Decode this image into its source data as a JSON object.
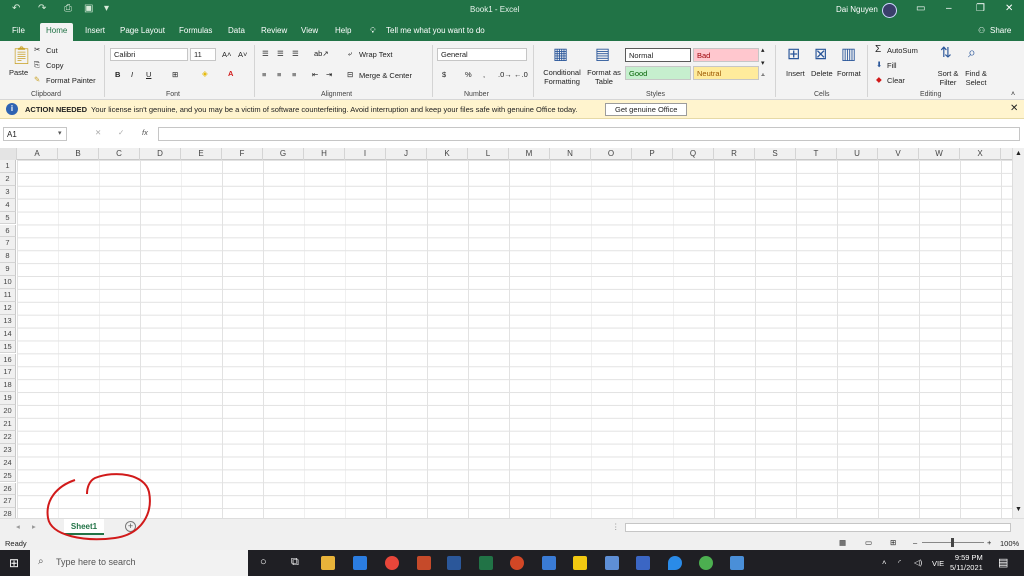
{
  "window": {
    "title": "Book1 - Excel",
    "user": "Dai Nguyen"
  },
  "ribbon_tabs": [
    "File",
    "Home",
    "Insert",
    "Page Layout",
    "Formulas",
    "Data",
    "Review",
    "View",
    "Help"
  ],
  "tell_me": "Tell me what you want to do",
  "share": "Share",
  "clipboard": {
    "paste": "Paste",
    "cut": "Cut",
    "copy": "Copy",
    "format_painter": "Format Painter",
    "label": "Clipboard"
  },
  "font": {
    "name": "Calibri",
    "size": "11",
    "label": "Font"
  },
  "alignment": {
    "wrap": "Wrap Text",
    "merge": "Merge & Center",
    "label": "Alignment"
  },
  "number": {
    "format": "General",
    "label": "Number"
  },
  "styles": {
    "conditional": "Conditional Formatting",
    "format_table": "Format as Table",
    "normal": "Normal",
    "bad": "Bad",
    "good": "Good",
    "neutral": "Neutral",
    "label": "Styles"
  },
  "cells": {
    "insert": "Insert",
    "delete": "Delete",
    "format": "Format",
    "label": "Cells"
  },
  "editing": {
    "autosum": "AutoSum",
    "fill": "Fill",
    "clear": "Clear",
    "sort": "Sort & Filter",
    "find": "Find & Select",
    "label": "Editing"
  },
  "message": {
    "title": "ACTION NEEDED",
    "text": "Your license isn't genuine, and you may be a victim of software counterfeiting. Avoid interruption and keep your files safe with genuine Office today.",
    "button": "Get genuine Office"
  },
  "formula": {
    "namebox": "A1",
    "fx": "fx"
  },
  "columns": [
    "A",
    "B",
    "C",
    "D",
    "E",
    "F",
    "G",
    "H",
    "I",
    "J",
    "K",
    "L",
    "M",
    "N",
    "O",
    "P",
    "Q",
    "R",
    "S",
    "T",
    "U",
    "V",
    "W",
    "X"
  ],
  "rows": [
    "1",
    "2",
    "3",
    "4",
    "5",
    "6",
    "7",
    "8",
    "9",
    "10",
    "11",
    "12",
    "13",
    "14",
    "15",
    "16",
    "17",
    "18",
    "19",
    "20",
    "21",
    "22",
    "23",
    "24",
    "25",
    "26",
    "27",
    "28"
  ],
  "sheet": {
    "name": "Sheet1"
  },
  "status": {
    "ready": "Ready",
    "zoom": "100%"
  },
  "taskbar": {
    "search": "Type here to search",
    "lang": "VIE",
    "time": "9:59 PM",
    "date": "5/11/2021"
  },
  "colors": {
    "accent": "#217346",
    "annotation": "#d11a1a"
  }
}
